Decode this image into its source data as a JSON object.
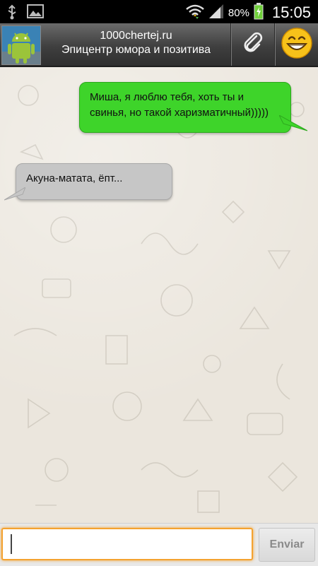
{
  "status_bar": {
    "battery_percent": "80%",
    "time": "15:05",
    "icons": [
      "usb-icon",
      "image-icon",
      "wifi-icon",
      "signal-icon",
      "battery-charging-icon"
    ]
  },
  "header": {
    "title": "1000chertej.ru",
    "subtitle": "Эпицентр юмора и позитива",
    "avatar_icon": "android-robot-icon",
    "attach_icon": "paperclip-icon",
    "emoji_icon": "smiley-icon"
  },
  "messages": [
    {
      "direction": "outgoing",
      "text_line1": "Миша, я люблю тебя, хоть ты и",
      "text_line2": "свинья, но такой харизматичный)))))"
    },
    {
      "direction": "incoming",
      "text": "Акуна-матата, ёпт..."
    }
  ],
  "composer": {
    "input_value": "",
    "send_label": "Enviar"
  },
  "colors": {
    "outgoing_bubble": "#3ed42a",
    "incoming_bubble": "#c6c6c6",
    "input_focus": "#f4a230",
    "chat_background": "#ebe6dd"
  }
}
